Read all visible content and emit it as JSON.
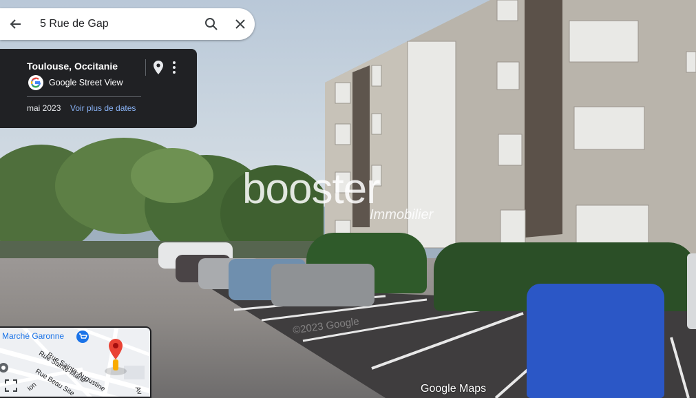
{
  "search": {
    "query": "5 Rue de Gap"
  },
  "info_card": {
    "location": "Toulouse, Occitanie",
    "provider": "Google Street View",
    "date": "mai 2023",
    "more_dates_link": "Voir plus de dates"
  },
  "watermark": {
    "brand": "booster",
    "sub": "Immobilier"
  },
  "minimap": {
    "labels": [
      "Marché Garonne",
      "Rue Sainte-Augustine",
      "Rue Sainte-Marie",
      "Rue Beau Site",
      "Av",
      "ion"
    ]
  },
  "footer": {
    "logo": "Google Maps",
    "faint_watermark": "©2023 Google"
  },
  "colors": {
    "card_bg": "#202124",
    "link": "#8ab4f8",
    "pin_red": "#ea4335"
  }
}
